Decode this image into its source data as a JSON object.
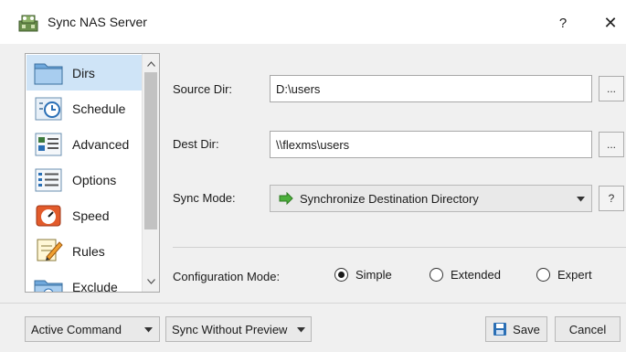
{
  "window": {
    "title": "Sync NAS Server",
    "help_label": "?",
    "close_label": "✕"
  },
  "sidebar": {
    "items": [
      {
        "label": "Dirs",
        "icon": "folder-icon",
        "selected": true
      },
      {
        "label": "Schedule",
        "icon": "schedule-icon"
      },
      {
        "label": "Advanced",
        "icon": "advanced-icon"
      },
      {
        "label": "Options",
        "icon": "options-icon"
      },
      {
        "label": "Speed",
        "icon": "speed-icon"
      },
      {
        "label": "Rules",
        "icon": "rules-icon"
      },
      {
        "label": "Exclude",
        "icon": "exclude-icon"
      }
    ]
  },
  "form": {
    "source": {
      "label": "Source Dir:",
      "value": "D:\\users",
      "browse": "..."
    },
    "dest": {
      "label": "Dest Dir:",
      "value": "\\\\flexms\\users",
      "browse": "..."
    },
    "sync_mode": {
      "label": "Sync Mode:",
      "value": "Synchronize Destination Directory",
      "help": "?"
    },
    "config_mode": {
      "label": "Configuration Mode:",
      "options": [
        {
          "label": "Simple",
          "checked": true
        },
        {
          "label": "Extended",
          "checked": false
        },
        {
          "label": "Expert",
          "checked": false
        }
      ]
    }
  },
  "bottom": {
    "command": "Active Command",
    "preview": "Sync Without Preview",
    "save": "Save",
    "cancel": "Cancel"
  },
  "colors": {
    "selection": "#cfe4f7",
    "sync_arrow": "#4caf3c",
    "save_icon": "#2a6fb5"
  }
}
